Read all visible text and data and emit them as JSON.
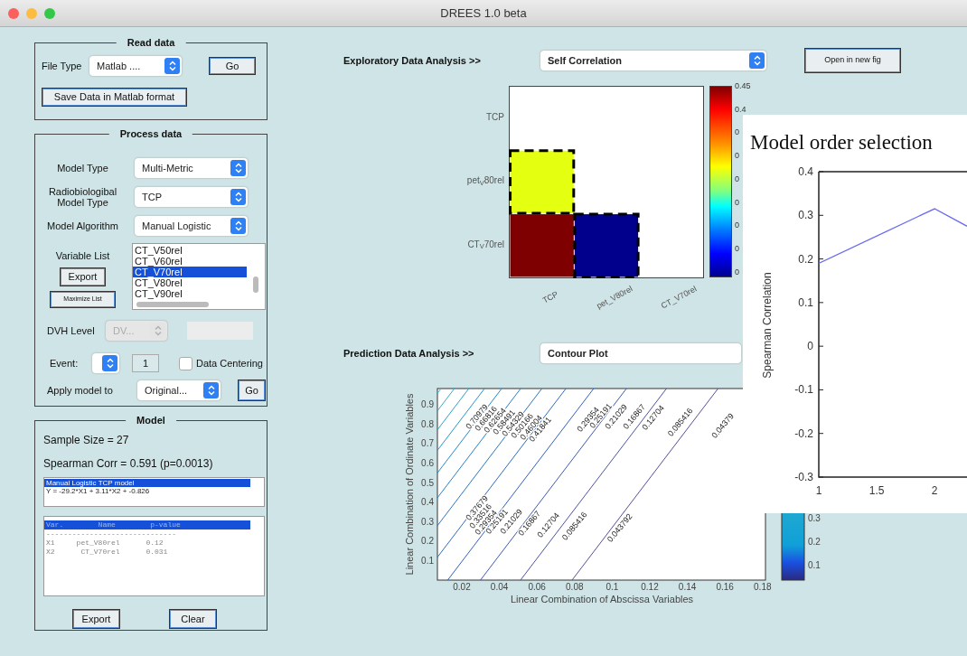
{
  "window": {
    "title": "DREES 1.0 beta"
  },
  "read_data": {
    "title": "Read data",
    "file_type": {
      "label": "File Type",
      "value": "Matlab ...."
    },
    "go_button": "Go",
    "save_button": "Save Data in Matlab format"
  },
  "process_data": {
    "title": "Process data",
    "rows": [
      {
        "label": "Model Type",
        "value": "Multi-Metric"
      },
      {
        "label": "Radiobiologibal Model Type",
        "value": "TCP"
      },
      {
        "label": "Model Algorithm",
        "value": "Manual Logistic"
      }
    ],
    "variable_list": {
      "label": "Variable List",
      "export_button": "Export",
      "maximize_button": "Maximize List",
      "items": [
        {
          "text": "CT_V50rel",
          "selected": false
        },
        {
          "text": "CT_V60rel",
          "selected": false
        },
        {
          "text": "CT_V70rel",
          "selected": true
        },
        {
          "text": "CT_V80rel",
          "selected": false
        },
        {
          "text": "CT_V90rel",
          "selected": false
        }
      ]
    },
    "dvh_level": {
      "label": "DVH Level",
      "value": "DV...",
      "disabled": true
    },
    "event": {
      "label": "Event:",
      "count": "1"
    },
    "data_centering": {
      "label": "Data Centering",
      "checked": false
    },
    "apply_model": {
      "label": "Apply model to",
      "value": "Original...",
      "go_button": "Go"
    }
  },
  "model": {
    "title": "Model",
    "sample_size": "Sample Size = 27",
    "spearman": "Spearman Corr = 0.591 (p=0.0013)",
    "equation_list": [
      {
        "text": "Manual Logistic TCP model",
        "selected": true
      },
      {
        "text": "Y = -29.2*X1 + 3.11*X2 + -0.826",
        "selected": false
      }
    ],
    "variable_table": [
      {
        "text": "Var.        Name        p-value",
        "selected": true
      },
      {
        "text": "------------------------------",
        "selected": false
      },
      {
        "text": "X1     pet_V80rel      0.12",
        "selected": false
      },
      {
        "text": "X2      CT_V70rel      0.031",
        "selected": false
      }
    ],
    "buttons": [
      "Export",
      "Clear"
    ]
  },
  "exploratory": {
    "label": "Exploratory Data Analysis >>",
    "select": "Self Correlation",
    "open_button": "Open in new fig",
    "heatmap": {
      "row_labels": [
        "TCP",
        "pet$_{V}$80rel",
        "CT$_{V}$70rel"
      ],
      "column_labels": [
        "TCP",
        "pet_V80rel",
        "CT_V70rel"
      ],
      "rows": [
        [
          {
            "kind": "empty"
          },
          {
            "kind": "empty"
          },
          {
            "kind": "empty"
          }
        ],
        [
          {
            "kind": "filled",
            "color": "#e5ff10",
            "dashed": true
          },
          {
            "kind": "empty"
          },
          {
            "kind": "empty"
          }
        ],
        [
          {
            "kind": "filled",
            "color": "#7f0000",
            "dashed": false
          },
          {
            "kind": "filled",
            "color": "#00008c",
            "dashed": true
          },
          {
            "kind": "empty"
          }
        ]
      ],
      "colorbar_labels": [
        "0.45",
        "0.4",
        "0",
        "0",
        "0",
        "0",
        "0",
        "0",
        "0"
      ]
    }
  },
  "prediction": {
    "label": "Prediction Data Analysis >>",
    "select": "Contour Plot",
    "contour": {
      "xlabel": "Linear Combination of Abscissa  Variables",
      "ylabel": "Linear Combination of  Ordinate Variables",
      "xticks": [
        "0.02",
        "0.04",
        "0.06",
        "0.08",
        "0.1",
        "0.12",
        "0.14",
        "0.16",
        "0.18"
      ],
      "yticks": [
        "0.9",
        "0.8",
        "0.7",
        "0.6",
        "0.5",
        "0.4",
        "0.3",
        "0.2",
        "0.1"
      ],
      "contour_labels": [
        [
          "0.70979",
          "0.66816",
          "0.62654",
          "0.58491",
          "0.54329",
          "0.50166",
          "0.46004",
          "0.41841"
        ],
        [
          "0.29354",
          "0.25191",
          "0.21029",
          "0.16867",
          "0.12704",
          "0.085416",
          "0.04379"
        ],
        [
          "0.37679",
          "0.33516",
          "0.29354",
          "0.25191",
          "0.21029",
          "0.16867",
          "0.12704",
          "0.085416",
          "0.043792"
        ]
      ],
      "colorbar_labels": [
        "0.3",
        "0.2",
        "0.1"
      ]
    }
  },
  "model_order_figure": {
    "chart_data": {
      "type": "line",
      "title": "Model order selection",
      "ylabel": "Spearman Correlation",
      "x": [
        1,
        2,
        2.28
      ],
      "series": [
        {
          "color": "#6b6bf0",
          "values": [
            0.19,
            0.315,
            0.275
          ]
        }
      ],
      "xlim": [
        1,
        2.28
      ],
      "ylim": [
        -0.3,
        0.4
      ],
      "xticks": [
        1,
        1.5,
        2
      ],
      "yticks": [
        0.4,
        0.3,
        0.2,
        0.1,
        0,
        -0.1,
        -0.2,
        -0.3
      ]
    }
  }
}
